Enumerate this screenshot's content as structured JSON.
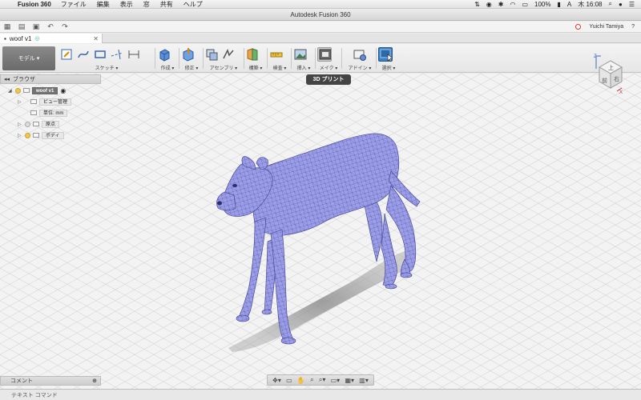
{
  "menubar": {
    "app_name": "Fusion 360",
    "menus": [
      "ファイル",
      "編集",
      "表示",
      "窓",
      "共有",
      "ヘルプ"
    ],
    "battery": "100%",
    "clock": "木 16:08",
    "input_source": "A"
  },
  "window": {
    "title": "Autodesk Fusion 360"
  },
  "quick_access": {
    "user_name": "Yuichi Tamiya"
  },
  "document_tab": {
    "name": "woof v1"
  },
  "ribbon": {
    "workspace": "モデル",
    "groups": {
      "sketch": "スケッチ",
      "create": "作成",
      "modify": "修正",
      "assemble": "アセンブリ",
      "construct": "構築",
      "inspect": "検査",
      "insert": "挿入",
      "make": "メイク",
      "addins": "アドイン",
      "select": "選択"
    },
    "tooltip": "3D プリント"
  },
  "browser": {
    "title": "ブラウザ",
    "root": "woof v1",
    "items": [
      "ビュー管理",
      "単位: mm",
      "原点",
      "ボディ"
    ]
  },
  "viewcube": {
    "top": "上",
    "front": "前",
    "right": "右"
  },
  "bottom": {
    "comments": "コメント",
    "text_command": "テキスト コマンド"
  },
  "colors": {
    "model": "#9c9ee8",
    "mesh": "#3a3d8f",
    "grid": "#d6d6d6",
    "tooltip_bg": "#444444"
  }
}
